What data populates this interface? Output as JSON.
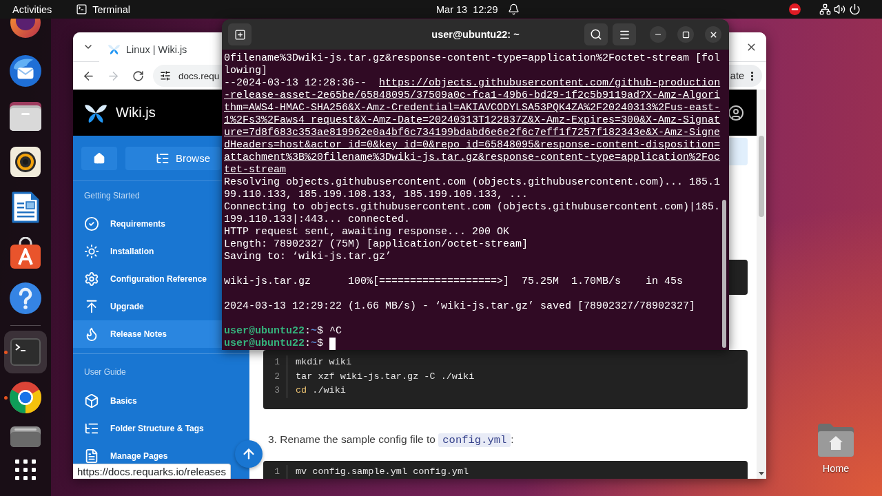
{
  "top_bar": {
    "activities": "Activities",
    "app_menu": "Terminal",
    "clock": "Mar 13  12:29"
  },
  "dock": {
    "items": [
      {
        "kind": "firefox",
        "running": false,
        "selected": false,
        "separator_before": false
      },
      {
        "kind": "thunderbird",
        "running": false,
        "selected": false,
        "separator_before": false
      },
      {
        "kind": "files",
        "running": false,
        "selected": false,
        "separator_before": false
      },
      {
        "kind": "rhythmbox",
        "running": false,
        "selected": false,
        "separator_before": false
      },
      {
        "kind": "writer",
        "running": false,
        "selected": false,
        "separator_before": false
      },
      {
        "kind": "software",
        "running": false,
        "selected": false,
        "separator_before": false
      },
      {
        "kind": "help",
        "running": false,
        "selected": false,
        "separator_before": false
      },
      {
        "kind": "terminal",
        "running": true,
        "selected": true,
        "separator_before": true
      },
      {
        "kind": "chrome",
        "running": true,
        "selected": false,
        "separator_before": false
      },
      {
        "kind": "drive",
        "running": false,
        "selected": false,
        "separator_before": false
      },
      {
        "kind": "show_apps",
        "running": false,
        "selected": false,
        "separator_before": false
      }
    ]
  },
  "desktop": {
    "icons": [
      {
        "label": "Home"
      }
    ]
  },
  "browser": {
    "tabs": [
      {
        "title": "Linux | Wiki.js",
        "selected": true
      }
    ],
    "back_disabled": false,
    "forward_disabled": true,
    "address": "docs.requ",
    "menu_label": "ate",
    "status_url": "https://docs.requarks.io/releases"
  },
  "wiki": {
    "brand": "Wiki.js",
    "browse": "Browse",
    "sections": [
      {
        "title": "Getting Started",
        "items": [
          {
            "label": "Requirements",
            "selected": false
          },
          {
            "label": "Installation",
            "selected": false
          },
          {
            "label": "Configuration Reference",
            "selected": false
          },
          {
            "label": "Upgrade",
            "selected": false
          },
          {
            "label": "Release Notes",
            "selected": true
          }
        ]
      },
      {
        "title": "User Guide",
        "items": [
          {
            "label": "Basics",
            "selected": false
          },
          {
            "label": "Folder Structure & Tags",
            "selected": false
          },
          {
            "label": "Manage Pages",
            "selected": false
          }
        ]
      }
    ],
    "content": [
      {
        "kind": "code",
        "lines": [
          {
            "number": "1",
            "tokens": [
              {
                "kind": "plain",
                "text": "mkdir wiki"
              }
            ]
          },
          {
            "number": "2",
            "tokens": [
              {
                "kind": "plain",
                "text": "tar xzf wiki-js.tar.gz -C ./wiki"
              }
            ]
          },
          {
            "number": "3",
            "tokens": [
              {
                "kind": "keyword",
                "text": "cd"
              },
              {
                "kind": "plain",
                "text": " ./wiki"
              }
            ]
          }
        ]
      },
      {
        "kind": "paragraph",
        "parts": [
          {
            "kind": "text",
            "text": "3. Rename the sample config file to "
          },
          {
            "kind": "code",
            "text": "config.yml"
          },
          {
            "kind": "text",
            "text": ":"
          }
        ]
      },
      {
        "kind": "code",
        "lines": [
          {
            "number": "1",
            "tokens": [
              {
                "kind": "plain",
                "text": "mv config.sample.yml config.yml"
              }
            ]
          }
        ]
      }
    ]
  },
  "terminal": {
    "title": "user@ubuntu22: ~",
    "rows": [
      {
        "kind": "text",
        "text": "0filename%3Dwiki-js.tar.gz&response-content-type=application%2Foctet-stream [fol"
      },
      {
        "kind": "text",
        "text": "lowing]"
      },
      {
        "kind": "text",
        "text": "--2024-03-13 12:28:36--",
        "link": "https://objects.githubusercontent.com/github-production"
      },
      {
        "kind": "text",
        "link": "-release-asset-2e65be/65848095/37509a0c-fca1-49b6-bd29-1f2c5b9119ad?X-Amz-Algori"
      },
      {
        "kind": "text",
        "link": "thm=AWS4-HMAC-SHA256&X-Amz-Credential=AKIAVCODYLSA53PQK4ZA%2F20240313%2Fus-east-"
      },
      {
        "kind": "text",
        "link": "1%2Fs3%2Faws4_request&X-Amz-Date=20240313T122837Z&X-Amz-Expires=300&X-Amz-Signat"
      },
      {
        "kind": "text",
        "link": "ure=7d8f683c353ae819962e0a4bf6c734199bdabd6e6e2f6c7eff1f7257f182343e&X-Amz-Signe"
      },
      {
        "kind": "text",
        "link": "dHeaders=host&actor_id=0&key_id=0&repo_id=65848095&response-content-disposition="
      },
      {
        "kind": "text",
        "link": "attachment%3B%20filename%3Dwiki-js.tar.gz&response-content-type=application%2Foc"
      },
      {
        "kind": "text",
        "link": "tet-stream"
      },
      {
        "kind": "text",
        "text": "Resolving objects.githubusercontent.com (objects.githubusercontent.com)... 185.1"
      },
      {
        "kind": "text",
        "text": "99.110.133, 185.199.108.133, 185.199.109.133, ..."
      },
      {
        "kind": "text",
        "text": "Connecting to objects.githubusercontent.com (objects.githubusercontent.com)|185."
      },
      {
        "kind": "text",
        "text": "199.110.133|:443... connected."
      },
      {
        "kind": "text",
        "text": "HTTP request sent, awaiting response... 200 OK"
      },
      {
        "kind": "text",
        "text": "Length: 78902327 (75M) [application/octet-stream]"
      },
      {
        "kind": "text",
        "text": "Saving to: ‘wiki-js.tar.gz’"
      },
      {
        "kind": "blank"
      },
      {
        "kind": "text",
        "text": "wiki-js.tar.gz      100%[===================>]  75.25M  1.70MB/s    in 45s"
      },
      {
        "kind": "blank"
      },
      {
        "kind": "text",
        "text": "2024-03-13 12:29:22 (1.66 MB/s) - ‘wiki-js.tar.gz’ saved [78902327/78902327]"
      },
      {
        "kind": "blank"
      },
      {
        "kind": "prompt",
        "user": "user@ubuntu22",
        "separator": ":",
        "path": "~",
        "symbol": "$",
        "command": "^C",
        "cursor": false
      },
      {
        "kind": "prompt",
        "user": "user@ubuntu22",
        "separator": ":",
        "path": "~",
        "symbol": "$",
        "cursor": true
      }
    ]
  }
}
